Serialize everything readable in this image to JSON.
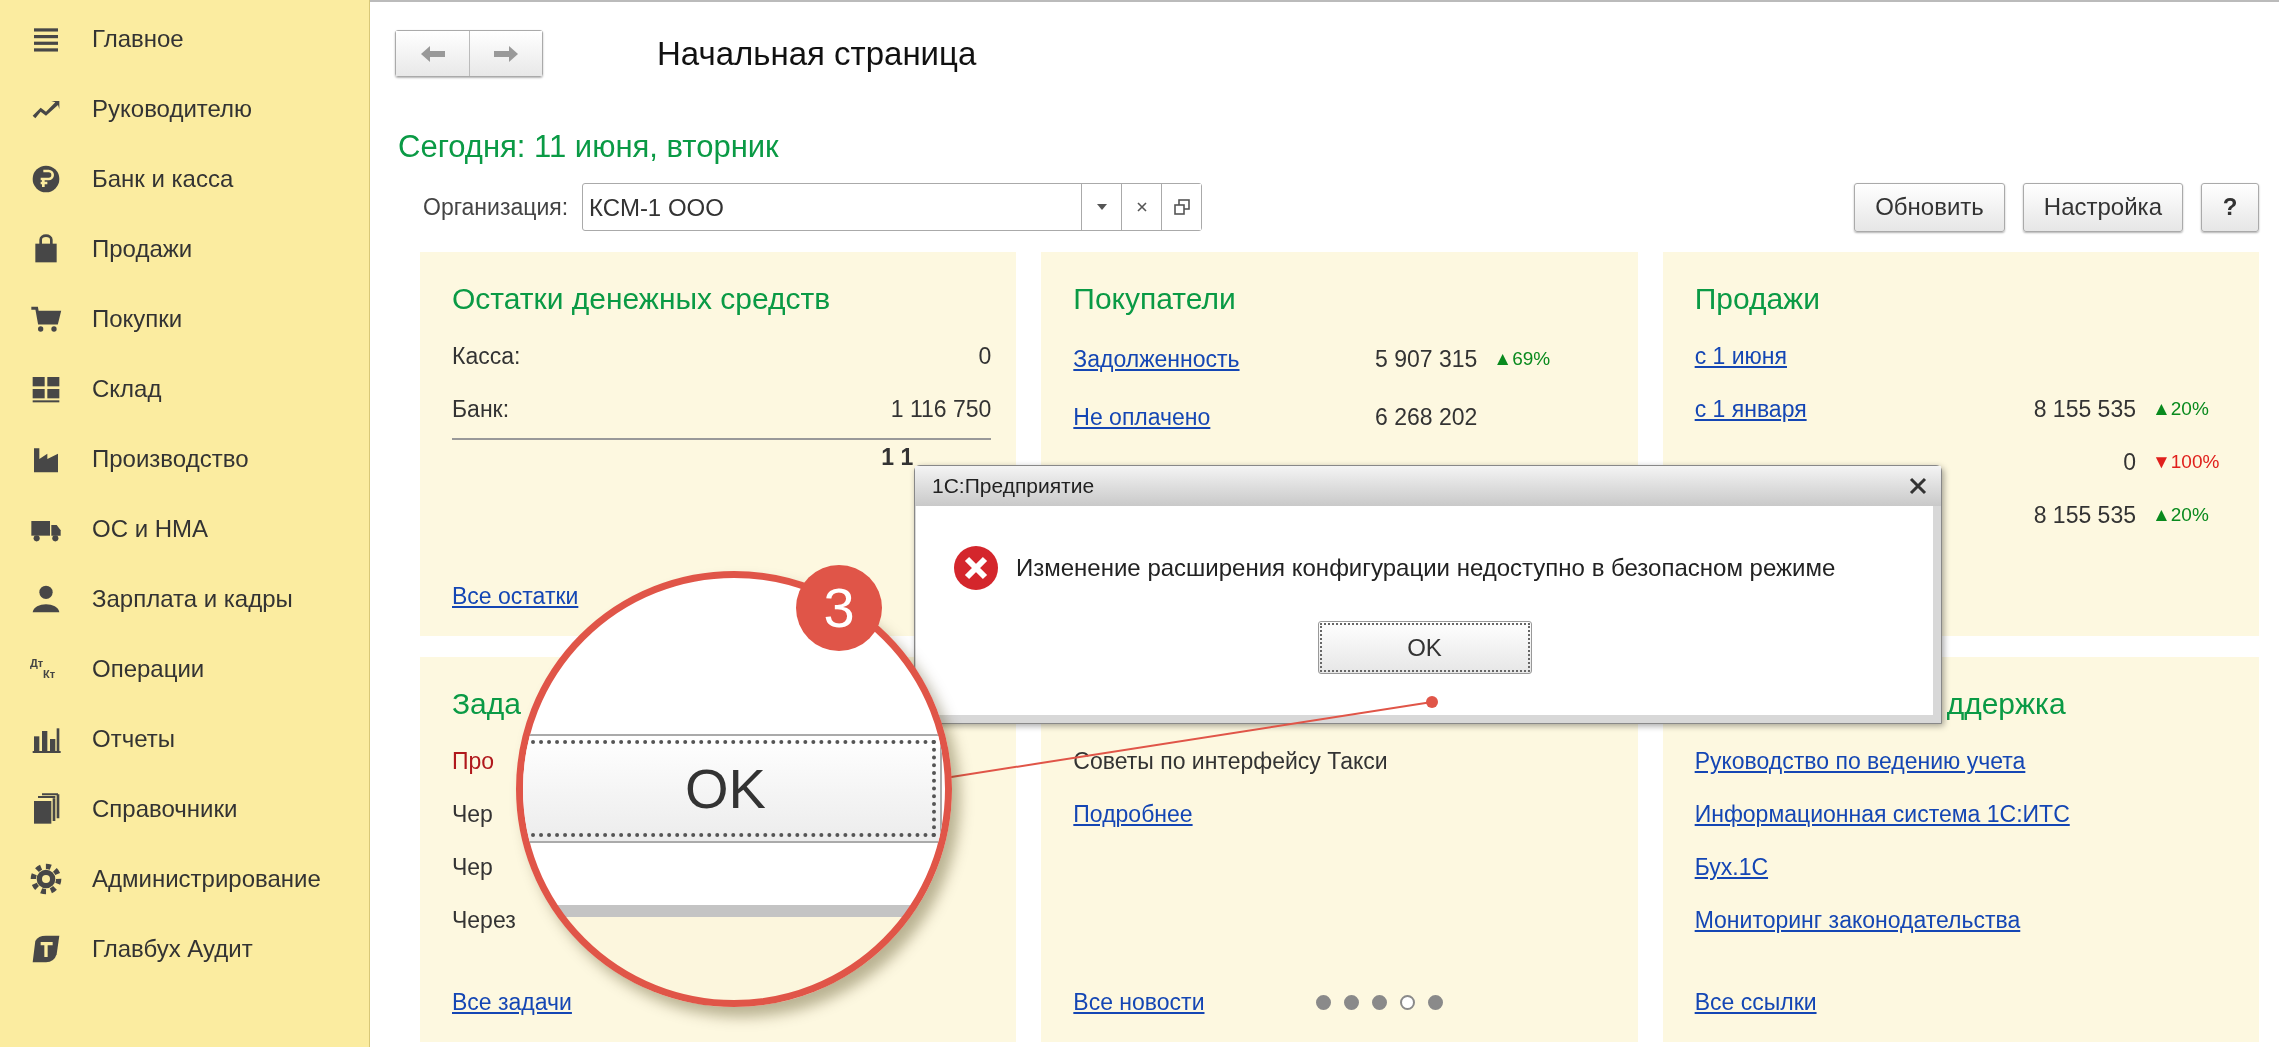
{
  "sidebar": {
    "items": [
      {
        "label": "Главное"
      },
      {
        "label": "Руководителю"
      },
      {
        "label": "Банк и касса"
      },
      {
        "label": "Продажи"
      },
      {
        "label": "Покупки"
      },
      {
        "label": "Склад"
      },
      {
        "label": "Производство"
      },
      {
        "label": "ОС и НМА"
      },
      {
        "label": "Зарплата и кадры"
      },
      {
        "label": "Операции",
        "icon_text": "Дт Кт"
      },
      {
        "label": "Отчеты"
      },
      {
        "label": "Справочники"
      },
      {
        "label": "Администрирование"
      },
      {
        "label": "Главбух Аудит"
      }
    ]
  },
  "header": {
    "title": "Начальная страница",
    "today": "Сегодня: 11 июня, вторник"
  },
  "organization": {
    "label": "Организация:",
    "value": "КСМ-1 ООО"
  },
  "buttons": [
    "Обновить",
    "Настройка",
    "?"
  ],
  "cards": [
    {
      "title": "Остатки денежных средств",
      "rows": [
        {
          "kind": "pair",
          "label": "Касса:",
          "value": "0"
        },
        {
          "kind": "pair",
          "label": "Банк:",
          "value": "1 116 750"
        },
        {
          "kind": "total",
          "value": "1 1"
        }
      ],
      "footer_link": "Все остатки"
    },
    {
      "title": "Покупатели",
      "rows": [
        {
          "kind": "metric",
          "label": "Задолженность",
          "value": "5 907 315",
          "change": "▲69%",
          "rising": true
        },
        {
          "kind": "metric",
          "label": "Не оплачено",
          "value": "6 268 202"
        }
      ]
    },
    {
      "title": "Продажи",
      "rows": [
        {
          "kind": "metric",
          "label": "с 1 июня"
        },
        {
          "kind": "metric",
          "label": "с 1 января",
          "value": "8 155 535",
          "change": "▲20%",
          "rising": true
        },
        {
          "kind": "metric",
          "value": "0",
          "change": "▼100%",
          "rising": false
        },
        {
          "kind": "metric",
          "value": "8 155 535",
          "change": "▲20%",
          "rising": true
        }
      ]
    },
    {
      "title": "Зада",
      "rows": [
        {
          "kind": "alert",
          "text": "Про"
        },
        {
          "kind": "text",
          "text": "Чер"
        },
        {
          "kind": "text",
          "text": "Чер"
        },
        {
          "kind": "text",
          "text": "Через"
        }
      ],
      "footer_link": "Все задачи"
    },
    {
      "rows": [
        {
          "kind": "text",
          "text": "Советы по интерфейсу Такси"
        },
        {
          "kind": "link",
          "text": "Подробнее"
        }
      ],
      "footer_link": "Все новости",
      "pager": [
        {
          "selected": false
        },
        {
          "selected": false
        },
        {
          "selected": false
        },
        {
          "selected": true
        },
        {
          "selected": false
        }
      ]
    },
    {
      "title": "ддержка",
      "rows": [
        {
          "kind": "link",
          "text": "Руководство по ведению учета"
        },
        {
          "kind": "link",
          "text": "Информационная система 1С:ИТС"
        },
        {
          "kind": "link",
          "text": "Бух.1С"
        },
        {
          "kind": "link",
          "text": "Мониторинг законодательства"
        }
      ],
      "footer_link": "Все ссылки"
    }
  ],
  "dialog": {
    "title": "1С:Предприятие",
    "message": "Изменение расширения конфигурации недоступно в безопасном режиме",
    "button": "OK"
  },
  "callout": {
    "number": "3",
    "button": "OK"
  }
}
